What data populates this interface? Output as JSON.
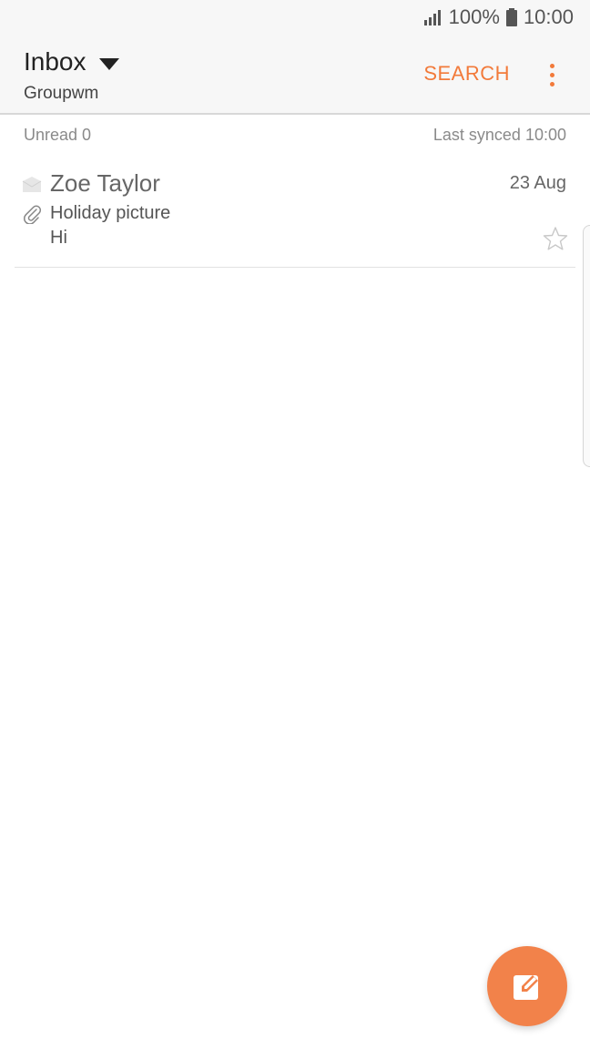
{
  "status_bar": {
    "battery": "100%",
    "time": "10:00"
  },
  "header": {
    "title": "Inbox",
    "account": "Groupwm",
    "search_label": "SEARCH"
  },
  "info": {
    "unread": "Unread 0",
    "last_synced": "Last synced  10:00"
  },
  "emails": [
    {
      "sender": "Zoe Taylor",
      "date": "23 Aug",
      "subject": "Holiday picture",
      "preview": "Hi",
      "has_attachment": true,
      "starred": false
    }
  ],
  "colors": {
    "accent": "#f27a3a",
    "fab": "#f2824a"
  },
  "icons": {
    "signal": "signal-icon",
    "battery": "battery-icon",
    "dropdown": "caret-down-icon",
    "more": "more-vertical-icon",
    "envelope": "envelope-icon",
    "attachment": "paperclip-icon",
    "star": "star-outline-icon",
    "compose": "compose-icon"
  }
}
